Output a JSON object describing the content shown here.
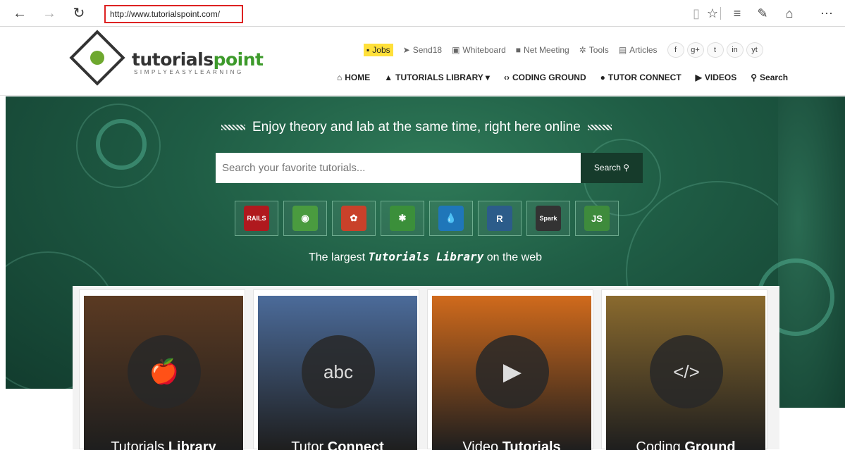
{
  "browser": {
    "url": "http://www.tutorialspoint.com/",
    "back_icon": "←",
    "forward_icon": "→",
    "refresh_icon": "↻",
    "reading_icon": "▯",
    "favorite_icon": "☆",
    "hub_icon": "≡",
    "note_icon": "✎",
    "share_icon": "⌂",
    "more_icon": "⋯"
  },
  "logo": {
    "text_main": "tutorials",
    "text_accent": "point",
    "tagline": "SIMPLYEASYLEARNING"
  },
  "topline": {
    "items": [
      {
        "label": "Jobs",
        "icon": "▪"
      },
      {
        "label": "Send18",
        "icon": "➤"
      },
      {
        "label": "Whiteboard",
        "icon": "▣"
      },
      {
        "label": "Net Meeting",
        "icon": "■"
      },
      {
        "label": "Tools",
        "icon": "✲"
      },
      {
        "label": "Articles",
        "icon": "▤"
      }
    ],
    "social": [
      "f",
      "g+",
      "t",
      "in",
      "yt"
    ]
  },
  "mainnav": {
    "items": [
      {
        "label": "HOME",
        "icon": "⌂"
      },
      {
        "label": "TUTORIALS LIBRARY ▾",
        "icon": "▲"
      },
      {
        "label": "CODING GROUND",
        "icon": "‹›"
      },
      {
        "label": "TUTOR CONNECT",
        "icon": "●"
      },
      {
        "label": "VIDEOS",
        "icon": "▶"
      },
      {
        "label": "Search",
        "icon": "⚲"
      }
    ]
  },
  "hero": {
    "tagline": "Enjoy theory and lab at the same time, right here online",
    "search_placeholder": "Search your favorite tutorials...",
    "search_button": "Search",
    "search_icon": "⚲",
    "subtitle_pre": "The largest",
    "subtitle_bold": "Tutorials Library",
    "subtitle_post": "on the web",
    "tiles": [
      {
        "name": "rails",
        "label": "RAILS",
        "color": "#b0191e"
      },
      {
        "name": "google-maps",
        "label": "◉",
        "color": "#4a9b3f"
      },
      {
        "name": "hadoop-cluster",
        "label": "✿",
        "color": "#c9412a"
      },
      {
        "name": "joomla",
        "label": "✱",
        "color": "#3b8f3a"
      },
      {
        "name": "drupal",
        "label": "💧",
        "color": "#1f76b9"
      },
      {
        "name": "r-language",
        "label": "R",
        "color": "#2c5c8a"
      },
      {
        "name": "spark",
        "label": "Spark",
        "color": "#333333"
      },
      {
        "name": "nodejs",
        "label": "JS",
        "color": "#3e8b3c"
      }
    ]
  },
  "cards": [
    {
      "name": "tutorials-library",
      "pre": "Tutorials ",
      "bold": "Library",
      "icon": "🍎",
      "bg": "#5b3a22"
    },
    {
      "name": "tutor-connect",
      "pre": "Tutor ",
      "bold": "Connect",
      "icon": "abc",
      "bg": "#4b6b9a"
    },
    {
      "name": "video-tutorials",
      "pre": "Video ",
      "bold": "Tutorials",
      "icon": "▶",
      "bg": "#d06a1c"
    },
    {
      "name": "coding-ground",
      "pre": "Coding ",
      "bold": "Ground",
      "icon": "</>",
      "bg": "#8a6a2e"
    }
  ]
}
